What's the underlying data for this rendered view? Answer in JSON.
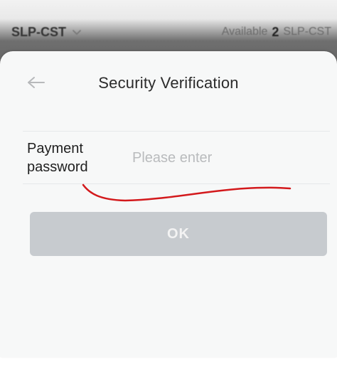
{
  "background": {
    "pair": "SLP-CST",
    "available_label": "Available",
    "available_amount": "2",
    "available_unit": "SLP-CST"
  },
  "sheet": {
    "title": "Security Verification",
    "field": {
      "label_line1": "Payment",
      "label_line2": "password",
      "placeholder": "Please enter",
      "value": ""
    },
    "ok_label": "OK"
  },
  "colors": {
    "button_disabled": "#c7cbcf",
    "annotation_red": "#d3191c"
  },
  "icons": {
    "back": "arrow-left-icon",
    "pair_toggle": "chevron-down-icon"
  }
}
